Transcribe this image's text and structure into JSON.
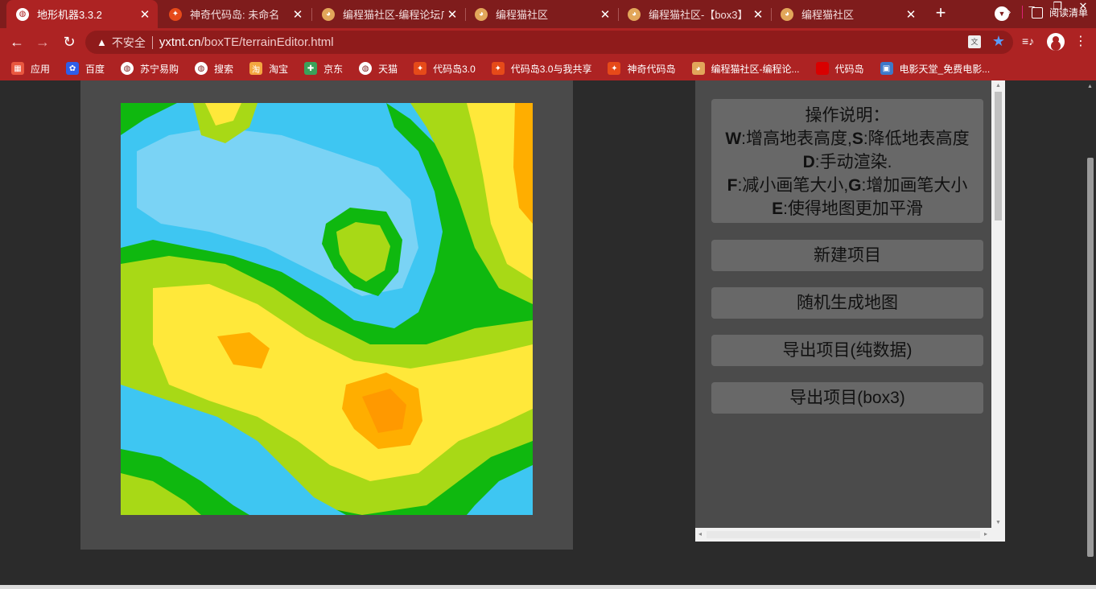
{
  "tabs": [
    {
      "title": "地形机器3.3.2",
      "icon": "globe-icon",
      "active": true
    },
    {
      "title": "神奇代码岛: 未命名",
      "icon": "maple-leaf-icon",
      "active": false
    },
    {
      "title": "编程猫社区-编程论坛广",
      "icon": "codemao-cat-icon",
      "active": false
    },
    {
      "title": "编程猫社区",
      "icon": "codemao-cat-icon",
      "active": false
    },
    {
      "title": "编程猫社区-【box3】",
      "icon": "codemao-cat-icon",
      "active": false
    },
    {
      "title": "编程猫社区",
      "icon": "codemao-cat-icon",
      "active": false
    }
  ],
  "toolbar": {
    "security_label": "不安全",
    "url_host": "yxtnt.cn",
    "url_path": "/boxTE/terrainEditor.html"
  },
  "bookmarks": [
    {
      "label": "应用",
      "icon": "apps-grid-icon",
      "color": "#e9573f"
    },
    {
      "label": "百度",
      "icon": "baidu-paw-icon",
      "color": "#2f5ee8"
    },
    {
      "label": "苏宁易购",
      "icon": "globe-icon",
      "color": "#7f1c1c"
    },
    {
      "label": "搜索",
      "icon": "globe-icon",
      "color": "#7f1c1c"
    },
    {
      "label": "淘宝",
      "icon": "taobao-icon",
      "color": "#f4a640"
    },
    {
      "label": "京东",
      "icon": "jd-icon",
      "color": "#3aa15a"
    },
    {
      "label": "天猫",
      "icon": "globe-icon",
      "color": "#7f1c1c"
    },
    {
      "label": "代码岛3.0",
      "icon": "maple-leaf-icon",
      "color": "#e64a19"
    },
    {
      "label": "代码岛3.0与我共享",
      "icon": "maple-leaf-icon",
      "color": "#e64a19"
    },
    {
      "label": "神奇代码岛",
      "icon": "maple-leaf-icon",
      "color": "#e64a19"
    },
    {
      "label": "编程猫社区-编程论...",
      "icon": "codemao-cat-icon",
      "color": "#e2a65a"
    },
    {
      "label": "代码岛",
      "icon": "red-square-icon",
      "color": "#d90000"
    },
    {
      "label": "电影天堂_免费电影...",
      "icon": "movie-icon",
      "color": "#3d78c9"
    }
  ],
  "bookmarks_more": "»",
  "reading_list": "阅读清单",
  "instructions": {
    "title": "操作说明：",
    "lines": [
      {
        "key": "W",
        "text": ":增高地表高度,",
        "key2": "S",
        "text2": ":降低地表高度"
      },
      {
        "key": "D",
        "text": ":手动渲染.",
        "key2": "",
        "text2": ""
      },
      {
        "key": "F",
        "text": ":减小画笔大小,",
        "key2": "G",
        "text2": ":增加画笔大小"
      },
      {
        "key": "E",
        "text": ":使得地图更加平滑",
        "key2": "",
        "text2": ""
      }
    ]
  },
  "buttons": {
    "new_project": "新建项目",
    "random_map": "随机生成地图",
    "export_data": "导出项目(纯数据)",
    "export_box3": "导出项目(box3)"
  },
  "colors": {
    "tabstrip": "#7f1c1c",
    "toolbar": "#ad2323",
    "panel": "#4b4b4b",
    "button": "#686868",
    "terrain_water": "#3ec6f2",
    "terrain_low": "#0fb80f",
    "terrain_mid": "#a8d916",
    "terrain_high": "#ffe83a",
    "terrain_peak": "#ffae00"
  }
}
